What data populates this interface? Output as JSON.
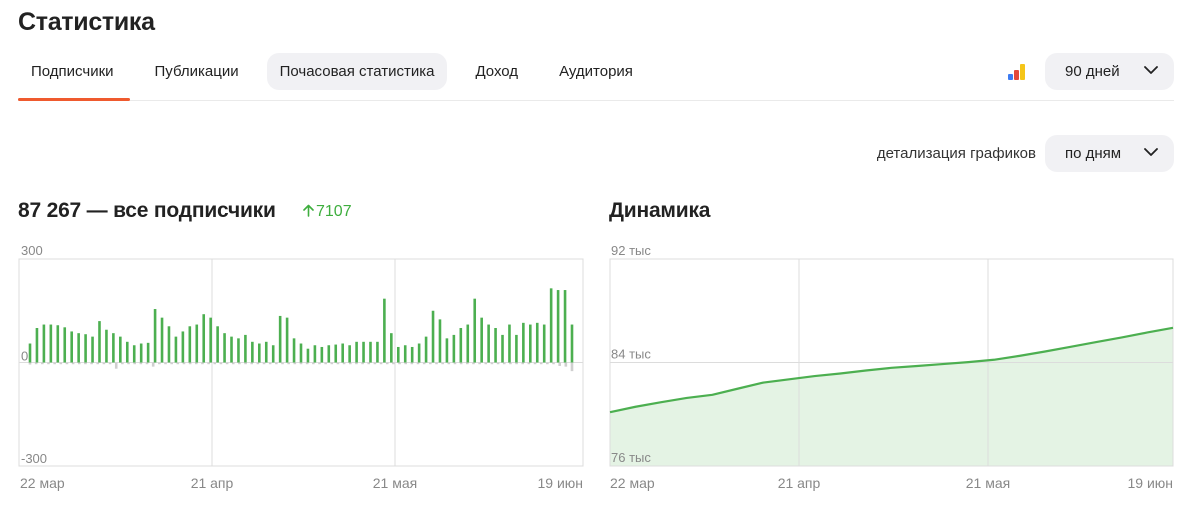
{
  "page": {
    "title": "Статистика"
  },
  "tabs": [
    {
      "label": "Подписчики",
      "active": true
    },
    {
      "label": "Публикации"
    },
    {
      "label": "Почасовая статистика",
      "highlighted": true
    },
    {
      "label": "Доход"
    },
    {
      "label": "Аудитория"
    }
  ],
  "toolbar": {
    "chart_icon": "bar-chart-icon",
    "period_value": "90 дней",
    "detail_label": "детализация графиков",
    "detail_value": "по дням"
  },
  "colors": {
    "accent_tab": "#ef5a2e",
    "positive": "#3eae3e",
    "bar_positive": "#4caf50",
    "bar_negative": "#cfcfcf",
    "line": "#4caf50",
    "area": "#e4f3e4",
    "icon_bars": [
      "#3d7bf2",
      "#e4493c",
      "#f5c518"
    ]
  },
  "subscribers": {
    "total": "87 267",
    "title_suffix": " — все подписчики",
    "delta": "7107"
  },
  "dynamics": {
    "title": "Динамика"
  },
  "chart_data": [
    {
      "type": "bar",
      "y_tick_labels": [
        "300",
        "0",
        "-300"
      ],
      "ylim": [
        -300,
        300
      ],
      "x_labels": [
        "22 мар",
        "21 апр",
        "21 мая",
        "19 июн"
      ],
      "grid": true,
      "series": [
        {
          "values": [
            55,
            100,
            110,
            110,
            108,
            102,
            90,
            85,
            82,
            75,
            120,
            95,
            85,
            75,
            60,
            50,
            55,
            57,
            155,
            130,
            105,
            75,
            90,
            105,
            110,
            140,
            130,
            105,
            85,
            75,
            70,
            80,
            60,
            55,
            60,
            50,
            135,
            130,
            70,
            55,
            40,
            50,
            45,
            50,
            52,
            55,
            50,
            60,
            60,
            60,
            60,
            185,
            85,
            45,
            50,
            45,
            55,
            75,
            150,
            125,
            70,
            80,
            100,
            110,
            185,
            130,
            110,
            100,
            80,
            110,
            80,
            115,
            110,
            115,
            110,
            215,
            210,
            210,
            110
          ]
        },
        {
          "values": [
            -6,
            -5,
            -5,
            -5,
            -5,
            -5,
            -5,
            -5,
            -5,
            -5,
            -5,
            -5,
            -5,
            -5,
            -18,
            -5,
            -5,
            -5,
            -5,
            -5,
            -12,
            -5,
            -5,
            -5,
            -5,
            -5,
            -5,
            -5,
            -5,
            -5,
            -5,
            -5,
            -5,
            -5,
            -5,
            -5,
            -5,
            -5,
            -5,
            -5,
            -5,
            -5,
            -5,
            -5,
            -5,
            -5,
            -5,
            -5,
            -5,
            -5,
            -5,
            -5,
            -5,
            -5,
            -5,
            -5,
            -5,
            -5,
            -5,
            -5,
            -5,
            -5,
            -5,
            -5,
            -5,
            -5,
            -5,
            -5,
            -5,
            -5,
            -5,
            -5,
            -5,
            -5,
            -5,
            -5,
            -5,
            -5,
            -5,
            -5,
            -5,
            -5,
            -5,
            -5,
            -5,
            -5,
            -10,
            -12,
            -25
          ]
        }
      ]
    },
    {
      "type": "area",
      "y_tick_labels": [
        "92 тыс",
        "84 тыс",
        "76 тыс"
      ],
      "ylim": [
        76000,
        92000
      ],
      "x_labels": [
        "22 мар",
        "21 апр",
        "21 мая",
        "19 июн"
      ],
      "grid": true,
      "x": [
        0,
        4,
        8,
        12,
        16,
        20,
        24,
        28,
        32,
        36,
        40,
        44,
        48,
        52,
        56,
        60,
        64,
        68,
        72,
        76,
        80,
        84,
        88
      ],
      "values": [
        80160,
        80580,
        80930,
        81260,
        81500,
        81980,
        82450,
        82700,
        82950,
        83150,
        83380,
        83590,
        83730,
        83880,
        84030,
        84210,
        84510,
        84850,
        85210,
        85580,
        85940,
        86320,
        86680
      ]
    }
  ]
}
